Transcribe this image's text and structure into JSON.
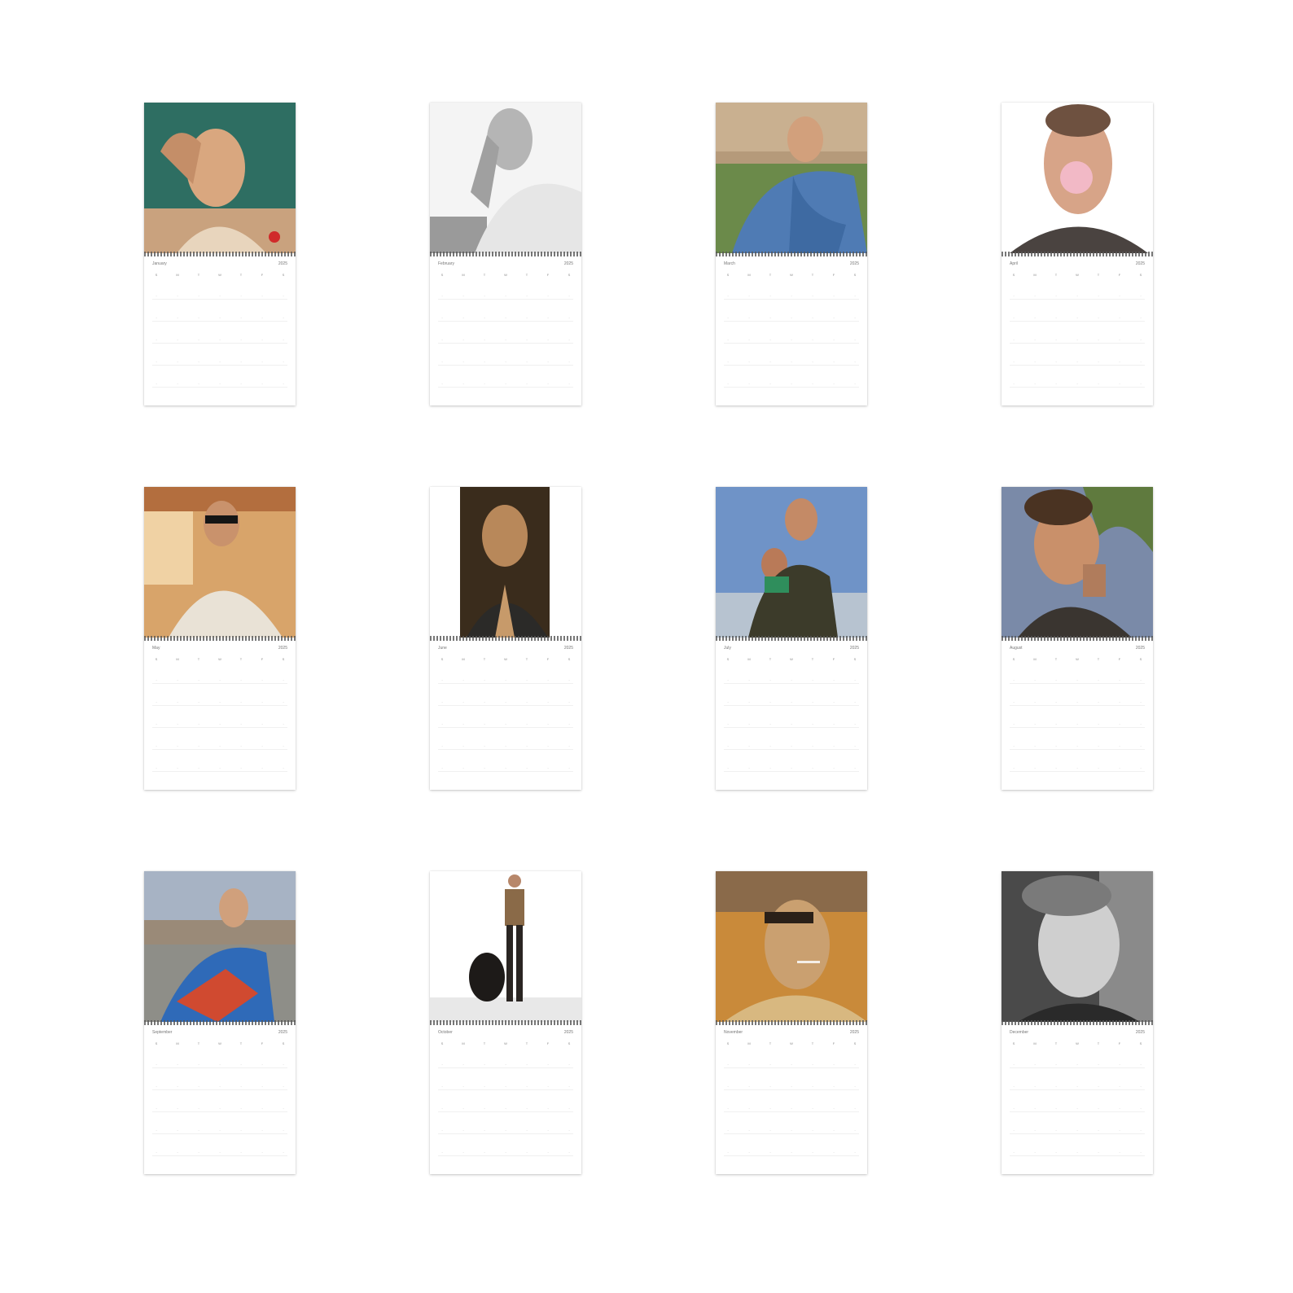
{
  "calendars": [
    {
      "month": "January",
      "year": "2025",
      "photo": "man-teal-background"
    },
    {
      "month": "February",
      "year": "2025",
      "photo": "man-black-white"
    },
    {
      "month": "March",
      "year": "2025",
      "photo": "man-denim-garden"
    },
    {
      "month": "April",
      "year": "2025",
      "photo": "man-bubblegum"
    },
    {
      "month": "May",
      "year": "2025",
      "photo": "man-sunglasses-tanktop"
    },
    {
      "month": "June",
      "year": "2025",
      "photo": "man-warm-portrait"
    },
    {
      "month": "July",
      "year": "2025",
      "photo": "two-people-sky"
    },
    {
      "month": "August",
      "year": "2025",
      "photo": "man-palm-leaves"
    },
    {
      "month": "September",
      "year": "2025",
      "photo": "man-colorful-jacket"
    },
    {
      "month": "October",
      "year": "2025",
      "photo": "man-with-dog"
    },
    {
      "month": "November",
      "year": "2025",
      "photo": "man-cigarette-sunlight"
    },
    {
      "month": "December",
      "year": "2025",
      "photo": "man-black-white-closeup"
    }
  ],
  "weekdays": [
    "S",
    "M",
    "T",
    "W",
    "T",
    "F",
    "S"
  ]
}
